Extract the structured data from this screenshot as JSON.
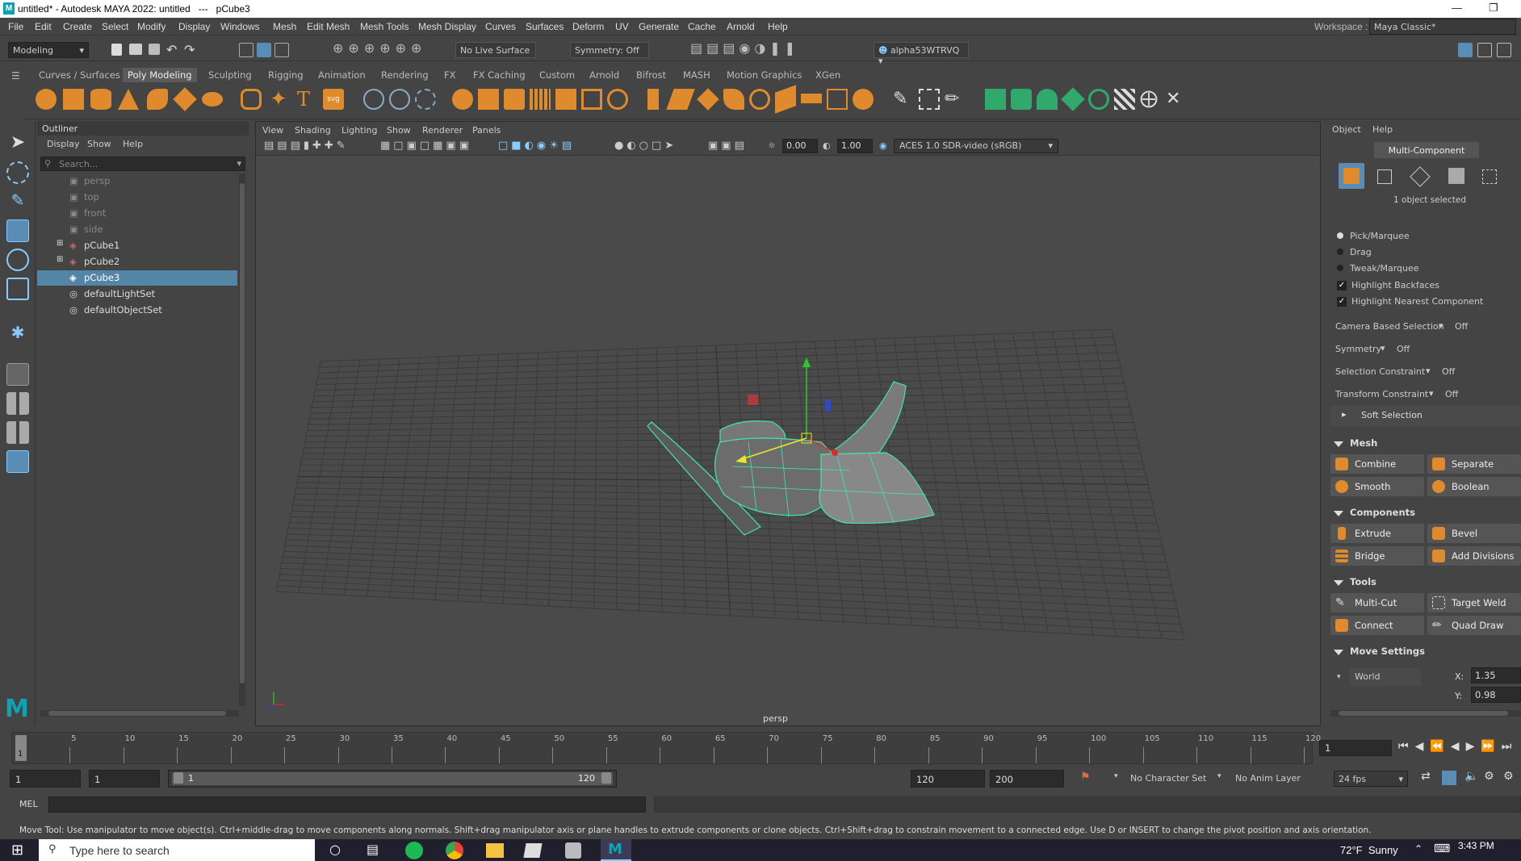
{
  "window": {
    "title": "untitled* - Autodesk MAYA 2022: untitled   ---   pCube3"
  },
  "menus": [
    "File",
    "Edit",
    "Create",
    "Select",
    "Modify",
    "Display",
    "Windows",
    "Mesh",
    "Edit Mesh",
    "Mesh Tools",
    "Mesh Display",
    "Curves",
    "Surfaces",
    "Deform",
    "UV",
    "Generate",
    "Cache",
    "Arnold",
    "Help"
  ],
  "workspace": {
    "label": "Workspace :",
    "value": "Maya Classic*"
  },
  "status": {
    "mode": "Modeling",
    "live_surface": "No Live Surface",
    "symmetry": "Symmetry: Off",
    "user": "alpha53WTRVQ"
  },
  "shelf_tabs": [
    "Curves / Surfaces",
    "Poly Modeling",
    "Sculpting",
    "Rigging",
    "Animation",
    "Rendering",
    "FX",
    "FX Caching",
    "Custom",
    "Arnold",
    "Bifrost",
    "MASH",
    "Motion Graphics",
    "XGen"
  ],
  "shelf_active": "Poly Modeling",
  "outliner": {
    "title": "Outliner",
    "menu": [
      "Display",
      "Show",
      "Help"
    ],
    "search_placeholder": "Search...",
    "items": [
      "persp",
      "top",
      "front",
      "side",
      "pCube1",
      "pCube2",
      "pCube3",
      "defaultLightSet",
      "defaultObjectSet"
    ],
    "selected": "pCube3"
  },
  "viewport": {
    "menu": [
      "View",
      "Shading",
      "Lighting",
      "Show",
      "Renderer",
      "Panels"
    ],
    "exposure": "0.00",
    "gamma": "1.00",
    "colorspace": "ACES 1.0 SDR-video (sRGB)",
    "camera_label": "persp"
  },
  "attr": {
    "menu": [
      "Object",
      "Help"
    ],
    "multi_component": "Multi-Component",
    "selected_count": "1 object selected",
    "pick_modes": [
      "Pick/Marquee",
      "Drag",
      "Tweak/Marquee"
    ],
    "checks": [
      "Highlight Backfaces",
      "Highlight Nearest Component"
    ],
    "options": [
      {
        "label": "Camera Based Selection",
        "value": "Off"
      },
      {
        "label": "Symmetry",
        "value": "Off"
      },
      {
        "label": "Selection Constraint",
        "value": "Off"
      },
      {
        "label": "Transform Constraint",
        "value": "Off"
      }
    ],
    "soft_selection": "Soft Selection",
    "sections": {
      "mesh": "Mesh",
      "components": "Components",
      "tools": "Tools",
      "move": "Move Settings"
    },
    "mesh_buttons": [
      "Combine",
      "Separate",
      "Smooth",
      "Boolean"
    ],
    "component_buttons": [
      "Extrude",
      "Bevel",
      "Bridge",
      "Add Divisions"
    ],
    "tool_buttons": [
      "Multi-Cut",
      "Target Weld",
      "Connect",
      "Quad Draw"
    ],
    "move": {
      "space": "World",
      "x_label": "X:",
      "x": "1.35",
      "y_label": "Y:",
      "y": "0.98"
    }
  },
  "timeline": {
    "ticks": [
      "5",
      "10",
      "15",
      "20",
      "25",
      "30",
      "35",
      "40",
      "45",
      "50",
      "55",
      "60",
      "65",
      "70",
      "75",
      "80",
      "85",
      "90",
      "95",
      "100",
      "105",
      "110",
      "115",
      "120"
    ],
    "current_marker": "1",
    "current_frame": "1"
  },
  "range": {
    "start": "1",
    "playback_start": "1",
    "slider_start": "1",
    "slider_end": "120",
    "playback_end": "120",
    "end": "200",
    "character": "No Character Set",
    "anim_layer": "No Anim Layer",
    "fps": "24 fps"
  },
  "mel": {
    "label": "MEL"
  },
  "help_line": "Move Tool: Use manipulator to move object(s). Ctrl+middle-drag to move components along normals. Shift+drag manipulator axis or plane handles to extrude components or clone objects. Ctrl+Shift+drag to constrain movement to a connected edge. Use D or INSERT to change the pivot position and axis orientation.",
  "taskbar": {
    "search": "Type here to search",
    "weather": "72°F  Sunny",
    "time": "3:43 PM"
  }
}
